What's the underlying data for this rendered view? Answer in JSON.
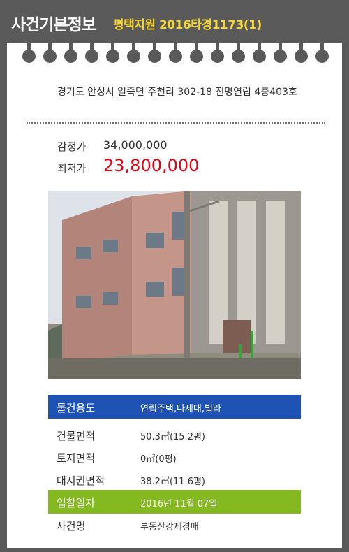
{
  "header": {
    "title": "사건기본정보",
    "subtitle": "평택지원 2016타경1173(1)"
  },
  "property": {
    "address": "경기도 안성시 일죽면 주천리 302-18 진명연립 4층403호"
  },
  "prices": {
    "appraisal_label": "감정가",
    "appraisal_value": "34,000,000",
    "minimum_label": "최저가",
    "minimum_value": "23,800,000"
  },
  "photo": {
    "icon": "building-photo"
  },
  "details": {
    "usage_label": "물건용도",
    "usage_value": "연립주택,다세대,빌라",
    "building_area_label": "건물면적",
    "building_area_value": "50.3㎡(15.2평)",
    "land_area_label": "토지면적",
    "land_area_value": "0㎡(0평)",
    "land_right_label": "대지권면적",
    "land_right_value": "38.2㎡(11.6평)",
    "bid_date_label": "입찰일자",
    "bid_date_value": "2016년 11월 07일",
    "case_name_label": "사건명",
    "case_name_value": "부동산강제경매"
  },
  "colors": {
    "background": "#5a5a5a",
    "subtitle": "#f5d633",
    "minimum_price": "#e60012",
    "usage_bar": "#1f53b3",
    "bid_date_bar": "#85b920"
  }
}
